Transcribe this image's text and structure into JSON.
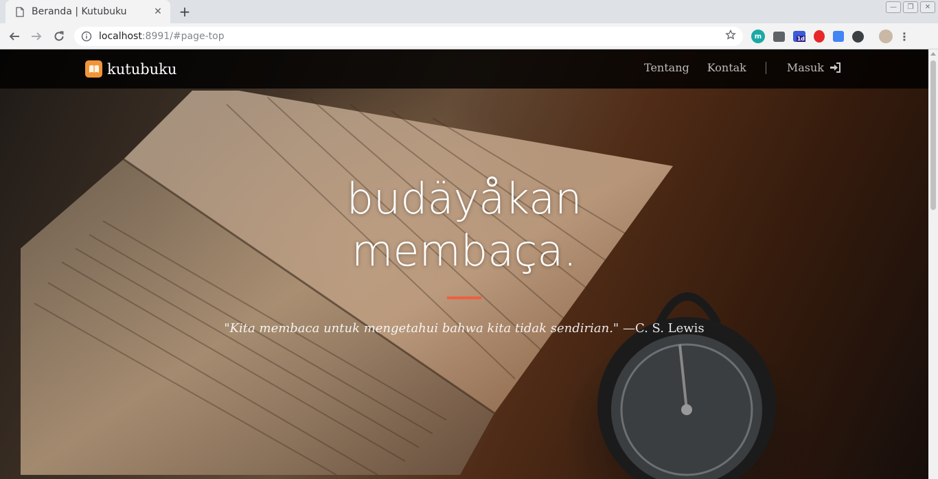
{
  "browser": {
    "tab_title": "Beranda | Kutubuku",
    "url_host": "localhost",
    "url_rest": ":8991/#page-top",
    "extensions": [
      {
        "icon": "m-extension-icon",
        "text": "m",
        "color": "#1ba9a5"
      },
      {
        "icon": "chat-extension-icon",
        "text": "",
        "color": "#5f6368"
      },
      {
        "icon": "calendar-extension-icon",
        "text": "1d",
        "color": "#3b5bdb"
      },
      {
        "icon": "opera-extension-icon",
        "text": "",
        "color": "#e8272a"
      },
      {
        "icon": "translate-extension-icon",
        "text": "",
        "color": "#4285f4"
      },
      {
        "icon": "settings-extension-icon",
        "text": "",
        "color": "#3c4043"
      }
    ]
  },
  "navbar": {
    "brand": "kutubuku",
    "links": [
      "Tentang",
      "Kontak"
    ],
    "login": "Masuk"
  },
  "hero": {
    "title_line1": "budäyåkan",
    "title_line2": "membaça.",
    "quote": "\"Kita membaca untuk mengetahui bahwa kita tidak sendirian.\"",
    "author": "—C. S. Lewis",
    "accent_color": "#f05f40"
  }
}
